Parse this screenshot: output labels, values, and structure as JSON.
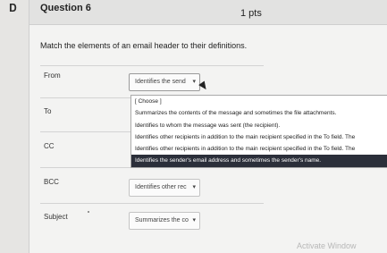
{
  "question": {
    "flag_icon": "bookmark-flag-icon",
    "title": "Question 6",
    "points": "1 pts",
    "prompt": "Match the elements of an email header to their definitions."
  },
  "rows": [
    {
      "label": "From",
      "selected": "Identifies the send"
    },
    {
      "label": "To",
      "selected": ""
    },
    {
      "label": "CC",
      "selected": ""
    },
    {
      "label": "BCC",
      "selected": "Identifies other rec"
    },
    {
      "label": "Subject",
      "selected": "Summarizes the co"
    }
  ],
  "dropdown": {
    "options": [
      "[ Choose ]",
      "Summarizes the contents of the message and sometimes the file attachments.",
      "Identifies to whom the message was sent (the recipient).",
      "Identifies other recipients in addition to the main recipient specified in the To field. The",
      "Identifies other recipients in addition to the main recipient specified in the To field. The",
      "Identifies the sender's email address and sometimes the sender's name."
    ],
    "highlighted_index": 5
  },
  "watermark": "Activate Window",
  "colors": {
    "highlight": "#2b2f3a",
    "card": "#f3f3f2",
    "header": "#e2e2e1"
  }
}
